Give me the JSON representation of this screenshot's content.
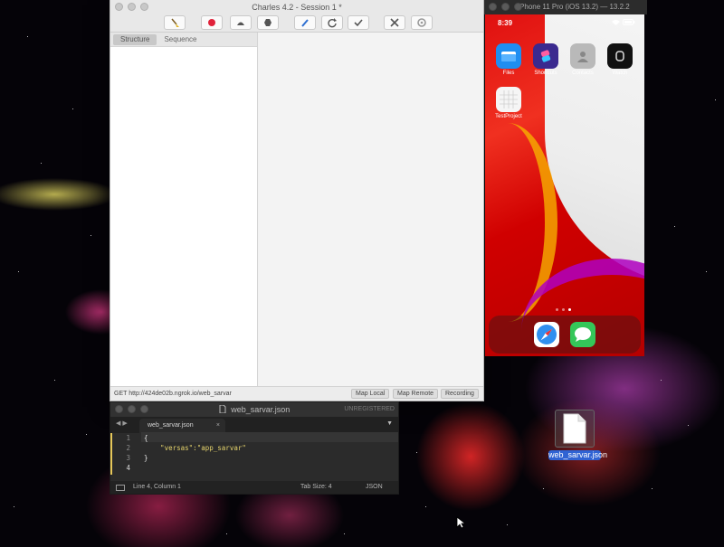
{
  "charles": {
    "title": "Charles 4.2 - Session 1 *",
    "tabs": [
      "Structure",
      "Sequence"
    ],
    "status_text": "GET http://424de02b.ngrok.io/web_sarvar",
    "buttons": {
      "map_local": "Map Local",
      "map_remote": "Map Remote",
      "recording": "Recording"
    },
    "toolbar_icons": [
      "broom-icon",
      "record-icon",
      "throttle-icon",
      "breakpoint-icon",
      "compose-icon",
      "repeat-icon",
      "validate-icon",
      "tools-icon",
      "settings-icon"
    ]
  },
  "simulator": {
    "title": "iPhone 11 Pro (iOS 13.2) — 13.2.2",
    "time": "8:39",
    "apps": [
      {
        "label": "Files",
        "color": "#1f8ef1"
      },
      {
        "label": "Shortcuts",
        "color": "#3b2a8f"
      },
      {
        "label": "Contacts",
        "color": "#b9b9b9"
      },
      {
        "label": "Watch",
        "color": "#111111"
      },
      {
        "label": "TestProject",
        "color": "#f5f5f5"
      }
    ],
    "dock": [
      {
        "name": "Safari",
        "color": "#2f8ff0"
      },
      {
        "name": "Messages",
        "color": "#34c759"
      }
    ]
  },
  "sublime": {
    "window_title": "web_sarvar.json",
    "unregistered": "UNREGISTERED",
    "tab_label": "web_sarvar.json",
    "lines": [
      "{",
      "    \"versas\":\"app_sarvar\"",
      "}",
      ""
    ],
    "line_numbers": [
      "1",
      "2",
      "3",
      "4"
    ],
    "status_position": "Line 4, Column 1",
    "status_tab_size": "Tab Size: 4",
    "status_syntax": "JSON"
  },
  "desktop": {
    "file_label": "web_sarvar.json"
  }
}
